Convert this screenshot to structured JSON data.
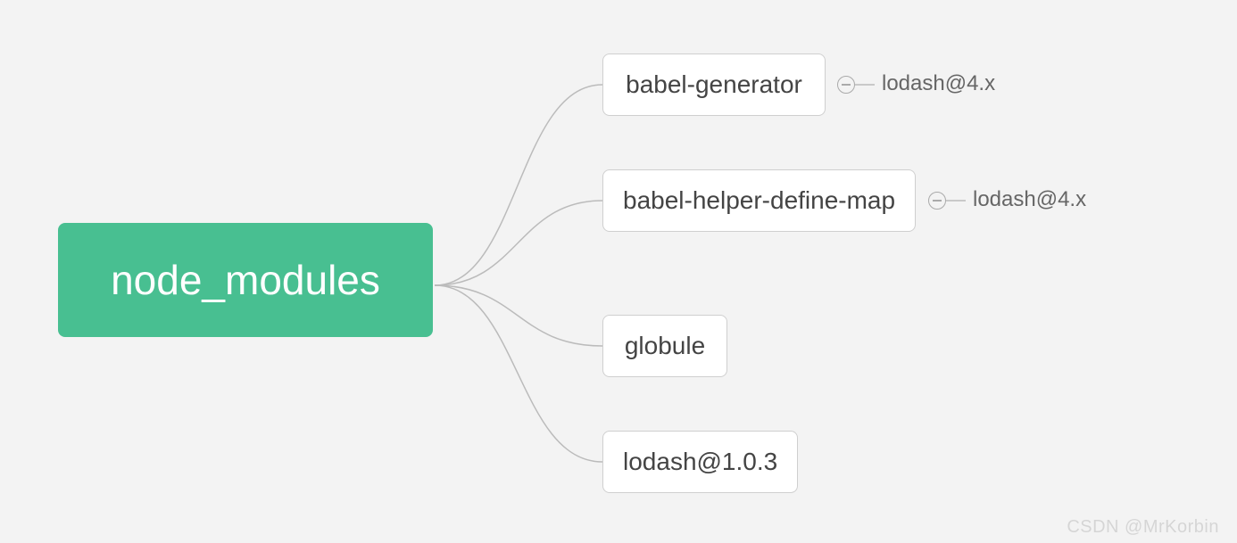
{
  "root": {
    "label": "node_modules"
  },
  "children": [
    {
      "label": "babel-generator",
      "leaf": "lodash@4.x"
    },
    {
      "label": "babel-helper-define-map",
      "leaf": "lodash@4.x"
    },
    {
      "label": "globule"
    },
    {
      "label": "lodash@1.0.3"
    }
  ],
  "watermark": "CSDN @MrKorbin"
}
